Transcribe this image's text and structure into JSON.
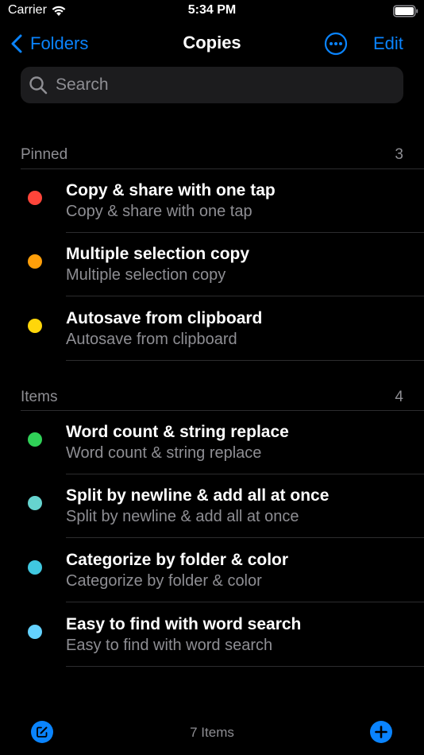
{
  "status_bar": {
    "carrier": "Carrier",
    "time": "5:34 PM",
    "wifi_icon": "wifi-icon",
    "battery_icon": "battery-icon"
  },
  "nav": {
    "back_label": "Folders",
    "title": "Copies",
    "more_icon": "ellipsis-circle-icon",
    "edit_label": "Edit"
  },
  "search": {
    "placeholder": "Search",
    "value": ""
  },
  "sections": [
    {
      "title": "Pinned",
      "count": "3",
      "items": [
        {
          "title": "Copy & share with one tap",
          "subtitle": "Copy & share with one tap",
          "color": "#ff453a"
        },
        {
          "title": "Multiple selection copy",
          "subtitle": "Multiple selection copy",
          "color": "#ff9f0a"
        },
        {
          "title": "Autosave from clipboard",
          "subtitle": "Autosave from clipboard",
          "color": "#ffd60a"
        }
      ]
    },
    {
      "title": "Items",
      "count": "4",
      "items": [
        {
          "title": "Word count & string replace",
          "subtitle": "Word count & string replace",
          "color": "#30d158"
        },
        {
          "title": "Split by newline & add all at once",
          "subtitle": "Split by newline & add all at once",
          "color": "#66d4cf"
        },
        {
          "title": "Categorize by folder & color",
          "subtitle": "Categorize by folder & color",
          "color": "#40c8e0"
        },
        {
          "title": "Easy to find with word search",
          "subtitle": "Easy to find with word search",
          "color": "#64d2ff"
        }
      ]
    }
  ],
  "toolbar": {
    "compose_icon": "compose-icon",
    "item_count": "7 Items",
    "add_icon": "plus-circle-icon"
  },
  "colors": {
    "accent": "#0a84ff",
    "background": "#000000",
    "secondary_text": "#8e8e93",
    "separator": "#2c2c2e"
  }
}
